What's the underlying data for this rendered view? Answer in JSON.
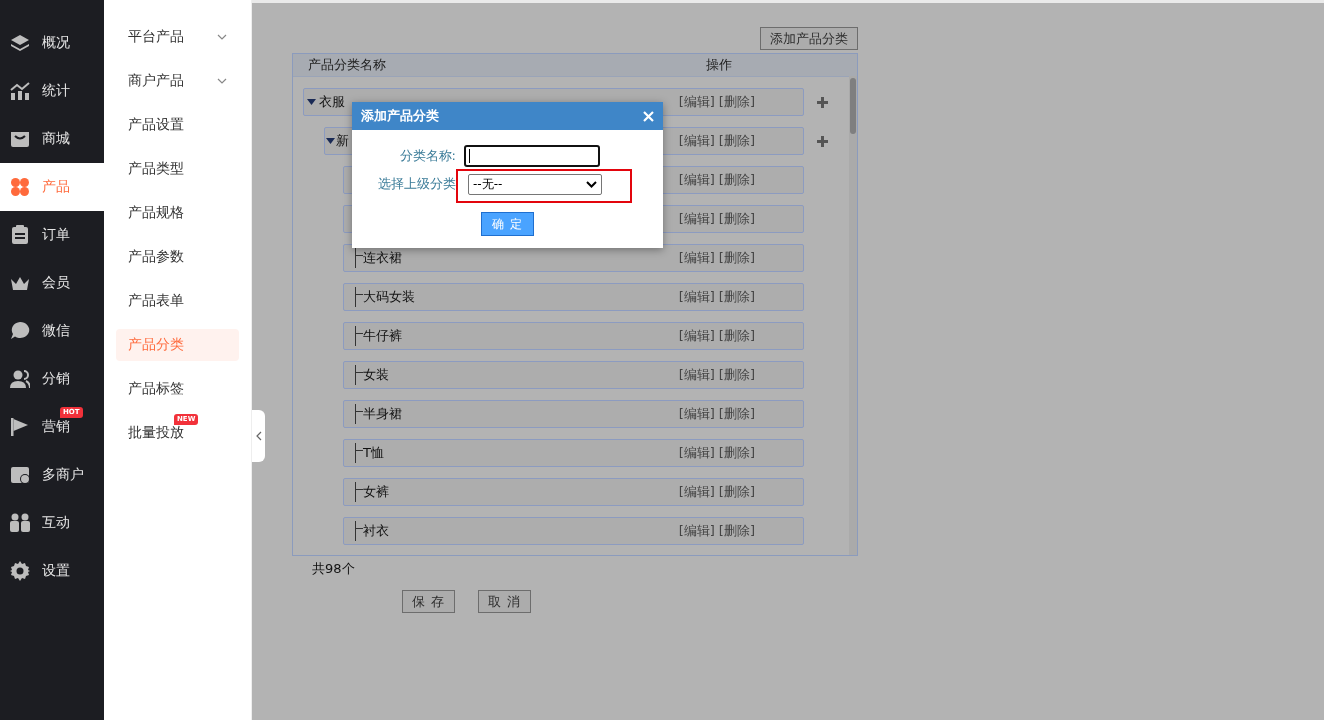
{
  "nav": {
    "items": [
      {
        "label": "概况",
        "selected": false
      },
      {
        "label": "统计",
        "selected": false
      },
      {
        "label": "商城",
        "selected": false
      },
      {
        "label": "产品",
        "selected": true
      },
      {
        "label": "订单",
        "selected": false
      },
      {
        "label": "会员",
        "selected": false
      },
      {
        "label": "微信",
        "selected": false
      },
      {
        "label": "分销",
        "selected": false
      },
      {
        "label": "营销",
        "selected": false,
        "badge": "HOT"
      },
      {
        "label": "多商户",
        "selected": false
      },
      {
        "label": "互动",
        "selected": false
      },
      {
        "label": "设置",
        "selected": false
      }
    ]
  },
  "subnav": {
    "items": [
      {
        "label": "平台产品",
        "selected": false,
        "expandable": true
      },
      {
        "label": "商户产品",
        "selected": false,
        "expandable": true
      },
      {
        "label": "产品设置",
        "selected": false
      },
      {
        "label": "产品类型",
        "selected": false
      },
      {
        "label": "产品规格",
        "selected": false
      },
      {
        "label": "产品参数",
        "selected": false
      },
      {
        "label": "产品表单",
        "selected": false
      },
      {
        "label": "产品分类",
        "selected": true
      },
      {
        "label": "产品标签",
        "selected": false
      },
      {
        "label": "批量投放",
        "selected": false,
        "badge": "NEW"
      }
    ]
  },
  "add_button": "添加产品分类",
  "table": {
    "columns": [
      "产品分类名称",
      "操作"
    ],
    "tree": [
      {
        "name": "衣服",
        "expanded": true,
        "actions": [
          "[编辑]",
          "[删除]"
        ],
        "children": [
          {
            "name": "新",
            "expanded": true,
            "actions": [
              "[编辑]",
              "[删除]"
            ],
            "children": [
              {
                "actions": [
                  "[编辑]",
                  "[删除]"
                ]
              },
              {
                "actions": [
                  "[编辑]",
                  "[删除]"
                ]
              },
              {
                "name": "连衣裙",
                "actions": [
                  "[编辑]",
                  "[删除]"
                ]
              },
              {
                "name": "大码女装",
                "actions": [
                  "[编辑]",
                  "[删除]"
                ]
              },
              {
                "name": "牛仔裤",
                "actions": [
                  "[编辑]",
                  "[删除]"
                ]
              },
              {
                "name": "女装",
                "actions": [
                  "[编辑]",
                  "[删除]"
                ]
              },
              {
                "name": "半身裙",
                "actions": [
                  "[编辑]",
                  "[删除]"
                ]
              },
              {
                "name": "T恤",
                "actions": [
                  "[编辑]",
                  "[删除]"
                ]
              },
              {
                "name": "女裤",
                "actions": [
                  "[编辑]",
                  "[删除]"
                ]
              },
              {
                "name": "衬衣",
                "actions": [
                  "[编辑]",
                  "[删除]"
                ]
              }
            ]
          }
        ]
      }
    ]
  },
  "count": "共98个",
  "footer_buttons": [
    "保 存",
    "取 消"
  ],
  "dialog": {
    "title": "添加产品分类",
    "fields": [
      {
        "kind": "text",
        "label": "分类名称:",
        "focused": true
      },
      {
        "kind": "select",
        "label": "选择上级分类",
        "value": "--无--",
        "highlighted": true
      }
    ],
    "confirm": "确 定"
  }
}
